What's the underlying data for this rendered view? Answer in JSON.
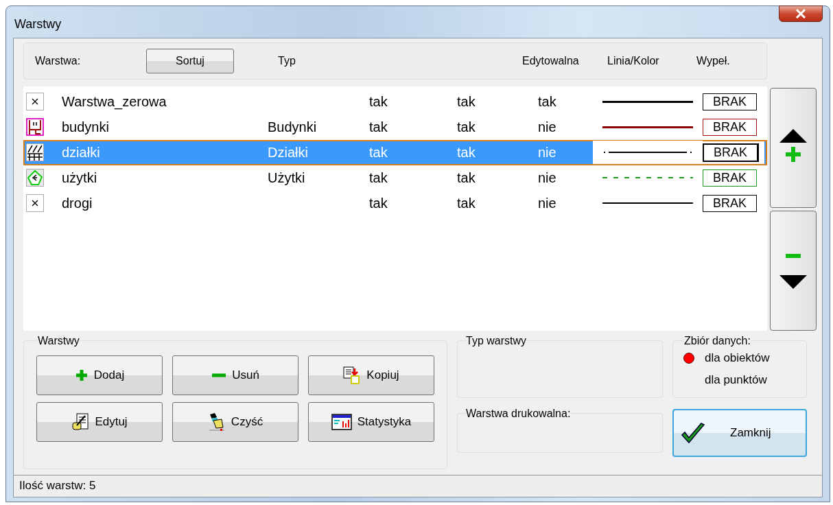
{
  "window": {
    "title": "Warstwy"
  },
  "header": {
    "layer_label": "Warstwa:",
    "sort_button": "Sortuj",
    "columns": [
      "Typ",
      "Edytowalna",
      "Linia/Kolor",
      "Wypeł."
    ]
  },
  "layers": [
    {
      "kind": "cross",
      "name": "Warstwa_zerowa",
      "column_3": "tak",
      "column_4": "tak",
      "editable": "tak",
      "line": {
        "kind": "thick",
        "color": "#000000"
      },
      "fill": {
        "text": "BRAK",
        "color": "#000000"
      },
      "selected": false
    },
    {
      "kind": "building",
      "name": "budynki",
      "type": "Budynki",
      "column_3": "tak",
      "column_4": "tak",
      "editable": "nie",
      "line": {
        "kind": "thick",
        "color": "#8b0000"
      },
      "fill": {
        "text": "BRAK",
        "color": "#a01010"
      },
      "selected": false
    },
    {
      "kind": "hatch",
      "name": "działki",
      "type": "Działki",
      "column_3": "tak",
      "column_4": "tak",
      "editable": "nie",
      "line": {
        "kind": "dotted",
        "color": "#000000"
      },
      "fill": {
        "text": "BRAK",
        "color": "#000000"
      },
      "selected": true
    },
    {
      "kind": "land",
      "name": "użytki",
      "type": "Użytki",
      "column_3": "tak",
      "column_4": "tak",
      "editable": "nie",
      "line": {
        "kind": "dashed",
        "color": "#1a9a1a"
      },
      "fill": {
        "text": "BRAK",
        "color": "#1a9a1a"
      },
      "selected": false
    },
    {
      "kind": "cross",
      "name": "drogi",
      "column_3": "tak",
      "column_4": "tak",
      "editable": "nie",
      "line": {
        "kind": "thin",
        "color": "#000000"
      },
      "fill": {
        "text": "BRAK",
        "color": "#000000"
      },
      "selected": false
    }
  ],
  "layers_group": {
    "title": "Warstwy",
    "buttons": [
      {
        "kind": "add",
        "label": "Dodaj"
      },
      {
        "kind": "remove",
        "label": "Usuń"
      },
      {
        "kind": "copy",
        "label": "Kopiuj"
      },
      {
        "kind": "edit",
        "label": "Edytuj"
      },
      {
        "kind": "clear",
        "label": "Czyść"
      },
      {
        "kind": "stats",
        "label": "Statystyka"
      }
    ]
  },
  "layer_type_group": {
    "title": "Typ warstwy"
  },
  "printable_group": {
    "title": "Warstwa drukowalna:"
  },
  "dataset_group": {
    "title": "Zbiór danych:",
    "options": [
      {
        "label": "dla obiektów",
        "selected": true
      },
      {
        "label": "dla punktów",
        "selected": false
      }
    ]
  },
  "close_button": "Zamknij",
  "status_bar": "Ilość warstw: 5"
}
